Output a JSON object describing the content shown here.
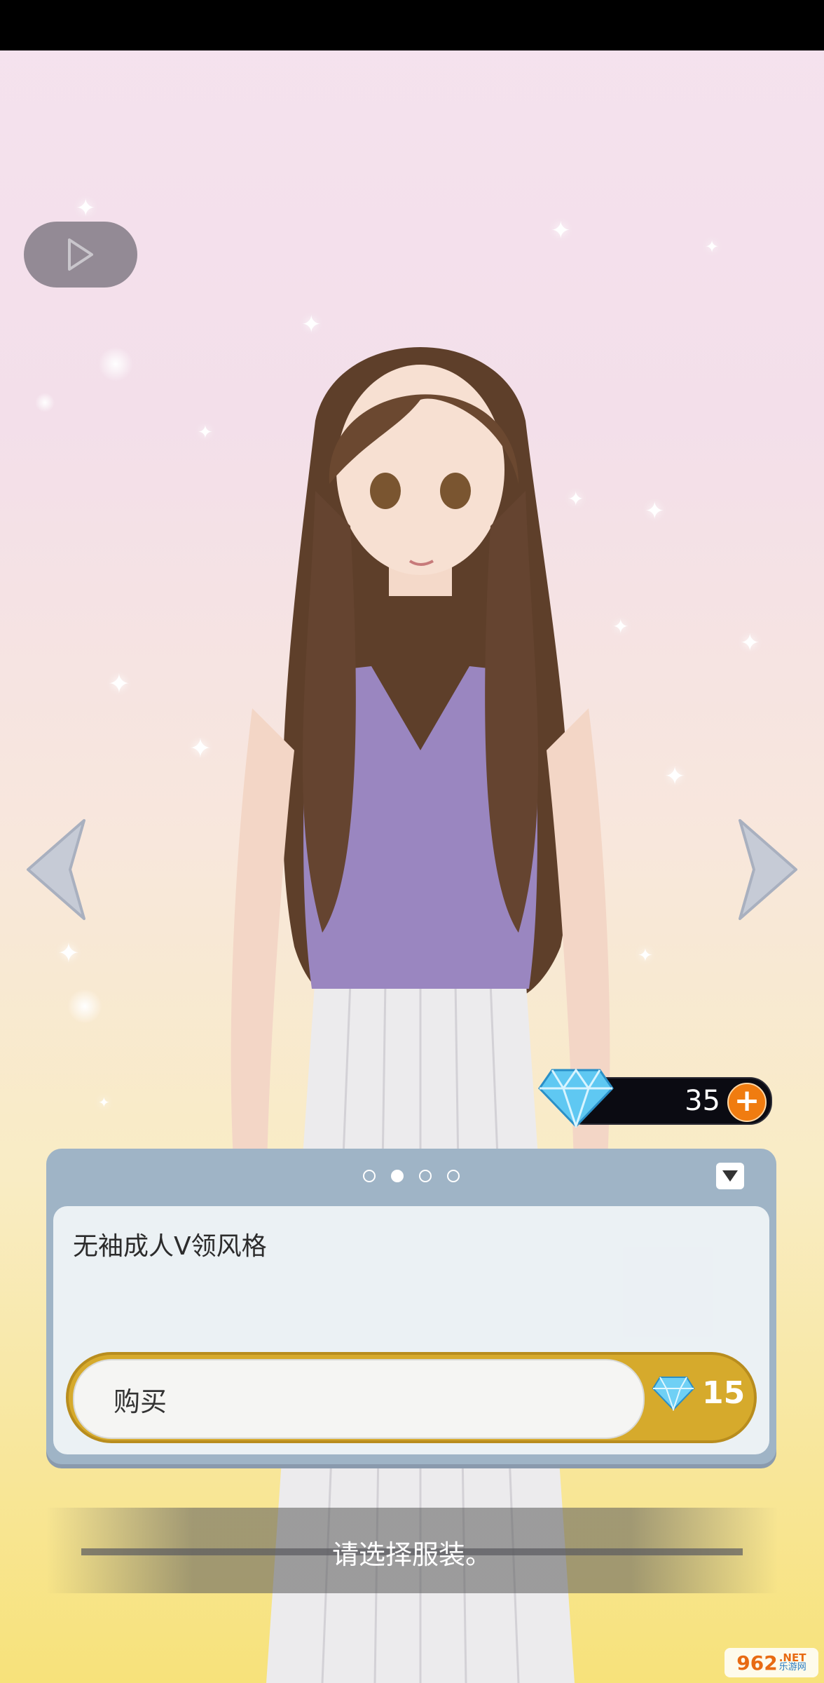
{
  "currency": {
    "amount": "35"
  },
  "panel": {
    "pages": 4,
    "active_page": 2,
    "item_name": "无袖成人V领风格",
    "buy_label": "购买",
    "price": "15"
  },
  "prompt": {
    "text": "请选择服装。"
  },
  "watermark": {
    "brand": "962",
    "suffix": ".NET",
    "sub": "乐游网"
  },
  "colors": {
    "accent_gold": "#d6aa2c",
    "plus_orange": "#f07c10",
    "panel_blue": "#9fb4c6"
  },
  "icons": [
    "play-icon",
    "arrow-left-icon",
    "arrow-right-icon",
    "diamond-icon",
    "plus-icon",
    "collapse-triangle-icon"
  ]
}
